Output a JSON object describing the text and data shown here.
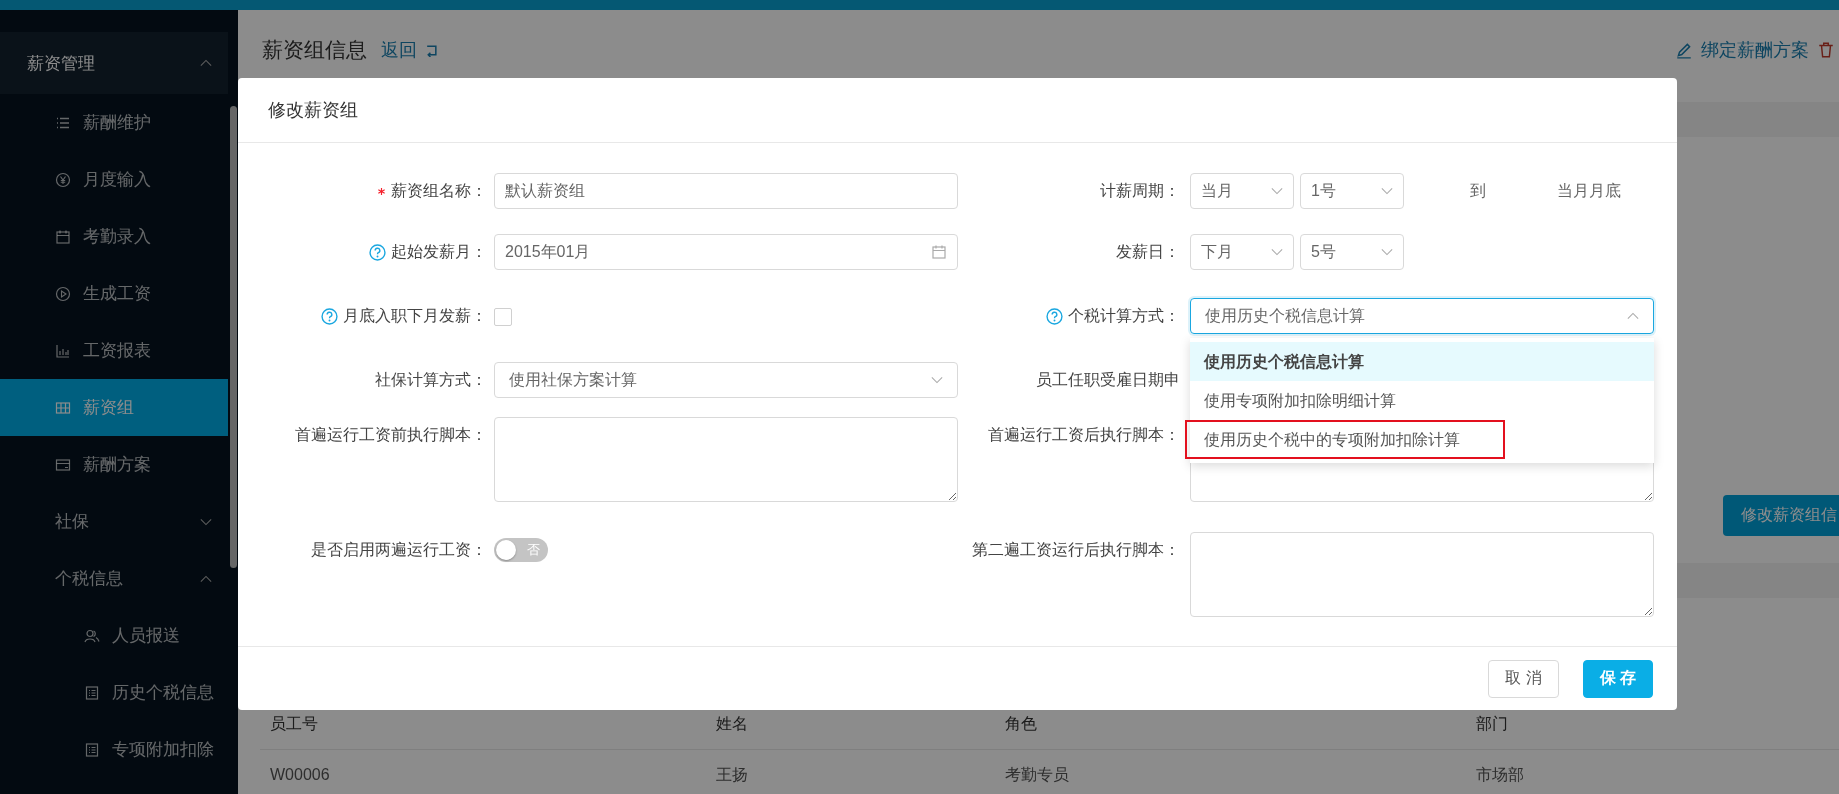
{
  "page_header": {
    "title": "薪资组信息",
    "back_link": "返回",
    "actions": [
      {
        "label": "绑定薪酬方案"
      }
    ]
  },
  "background_button": "修改薪资组信",
  "table": {
    "columns": [
      "员工号",
      "姓名",
      "角色",
      "部门"
    ],
    "rows": [
      [
        "W00006",
        "王扬",
        "考勤专员",
        "市场部"
      ]
    ]
  },
  "sidebar": {
    "items": [
      {
        "label": "薪资管理",
        "expanded": true,
        "selected": false,
        "children": [
          {
            "label": "薪酬维护",
            "selected": false
          },
          {
            "label": "月度输入",
            "selected": false
          },
          {
            "label": "考勤录入",
            "selected": false
          },
          {
            "label": "生成工资",
            "selected": false
          },
          {
            "label": "工资报表",
            "selected": false
          },
          {
            "label": "薪资组",
            "selected": true
          },
          {
            "label": "薪酬方案",
            "selected": false
          },
          {
            "label": "社保",
            "selected": false,
            "expanded": false
          },
          {
            "label": "个税信息",
            "selected": false,
            "expanded": true,
            "children": [
              {
                "label": "人员报送",
                "selected": false
              },
              {
                "label": "历史个税信息",
                "selected": false
              },
              {
                "label": "专项附加扣除",
                "selected": false
              }
            ]
          }
        ]
      }
    ]
  },
  "dialog": {
    "title": "修改薪资组",
    "rows": [
      {
        "left": {
          "kind": "text",
          "label": "薪资组名称：",
          "required": true,
          "value": "默认薪资组"
        },
        "right": {
          "kind": "range",
          "label": "计薪周期：",
          "selects": [
            "当月",
            "1号"
          ],
          "joiner": "到",
          "end": "当月月底"
        }
      },
      {
        "left": {
          "kind": "date",
          "label": "起始发薪月：",
          "help": true,
          "value": "2015年01月"
        },
        "right": {
          "kind": "range",
          "label": "发薪日：",
          "selects": [
            "下月",
            "5号"
          ]
        }
      },
      {
        "left": {
          "kind": "checkbox",
          "label": "月底入职下月发薪：",
          "help": true,
          "checked": false
        },
        "right": {
          "kind": "select",
          "label": "个税计算方式：",
          "help": true,
          "value": "使用历史个税信息计算",
          "open": true,
          "options": [
            {
              "label": "使用历史个税信息计算",
              "selected": true,
              "highlighted": false
            },
            {
              "label": "使用专项附加扣除明细计算",
              "selected": false,
              "highlighted": false
            },
            {
              "label": "使用历史个税中的专项附加扣除计算",
              "selected": false,
              "highlighted": true
            }
          ]
        }
      },
      {
        "left": {
          "kind": "select",
          "label": "社保计算方式：",
          "value": "使用社保方案计算",
          "open": false
        },
        "right": {
          "kind": "covered",
          "label": "员工任职受雇日期申"
        }
      },
      {
        "left": {
          "kind": "textarea",
          "label": "首遍运行工资前执行脚本："
        },
        "right": {
          "kind": "textarea",
          "label": "首遍运行工资后执行脚本："
        }
      },
      {
        "left": {
          "kind": "switch",
          "label": "是否启用两遍运行工资：",
          "on": false,
          "text": "否"
        },
        "right": {
          "kind": "textarea",
          "label": "第二遍工资运行后执行脚本："
        }
      }
    ],
    "buttons": [
      {
        "label": "取 消",
        "kind": "default"
      },
      {
        "label": "保 存",
        "kind": "primary"
      }
    ]
  }
}
